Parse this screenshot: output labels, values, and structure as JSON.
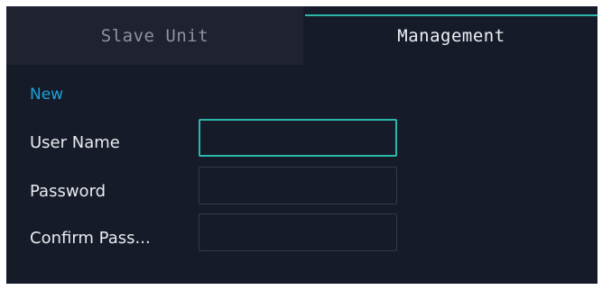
{
  "tabs": [
    {
      "label": "Slave Unit",
      "active": false
    },
    {
      "label": "Management",
      "active": true
    }
  ],
  "section": {
    "title": "New"
  },
  "form": {
    "user_name_label": "User Name",
    "user_name_value": "",
    "password_label": "Password",
    "password_value": "",
    "confirm_label": "Confirm Pass...",
    "confirm_value": ""
  },
  "colors": {
    "background": "#161b2a",
    "inactive_tab": "#1e2231",
    "accent": "#2bb7a9",
    "section_title": "#1aa3d6"
  }
}
